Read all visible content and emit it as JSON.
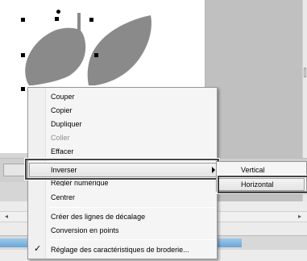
{
  "context_menu": {
    "items": [
      {
        "label": "Couper",
        "disabled": false
      },
      {
        "label": "Copier",
        "disabled": false
      },
      {
        "label": "Dupliquer",
        "disabled": false
      },
      {
        "label": "Coller",
        "disabled": true
      },
      {
        "label": "Effacer",
        "disabled": false
      },
      {
        "label": "Inverser",
        "disabled": false,
        "submenu": true,
        "highlighted": true
      },
      {
        "label": "Régler numérique",
        "disabled": false,
        "partially_hidden": true
      },
      {
        "label": "Centrer",
        "disabled": false
      },
      {
        "label": "Créer des lignes de décalage",
        "disabled": false
      },
      {
        "label": "Conversion en points",
        "disabled": false
      },
      {
        "label": "Réglage des caractéristiques de broderie...",
        "disabled": false,
        "checked": true
      }
    ]
  },
  "submenu": {
    "items": [
      {
        "label": "Vertical"
      },
      {
        "label": "Horizontal",
        "highlighted": true
      }
    ]
  },
  "colors": {
    "shape_fill": "#8a8a8a",
    "menu_bg": "#f5f5f5",
    "highlight_border": "#444444",
    "progress_fill": "#6aa6d6"
  },
  "icons": {
    "check": "checkmark-icon",
    "submenu_arrow": "triangle-right-icon"
  }
}
